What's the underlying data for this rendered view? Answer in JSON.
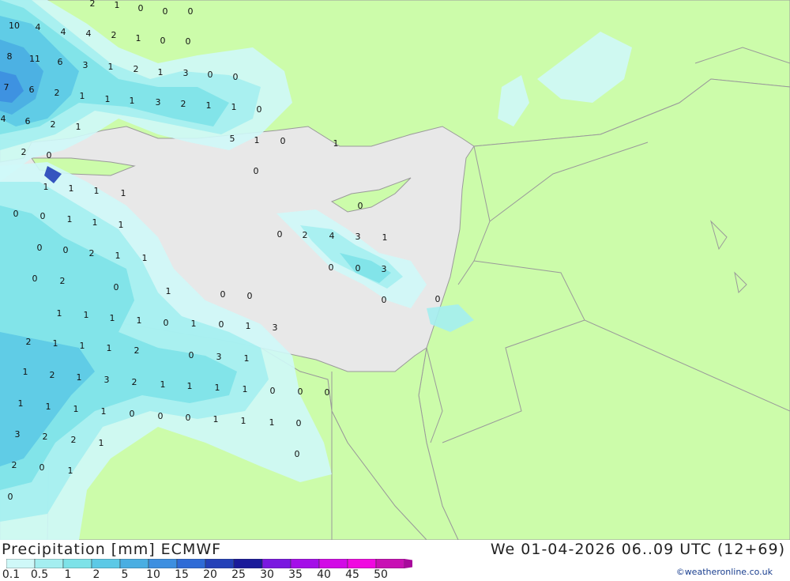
{
  "title": "Precipitation [mm] ECMWF",
  "datetime": "We 01-04-2026 06..09 UTC (12+69)",
  "credit": "©weatheronline.co.uk",
  "colors": {
    "sea": "#e8e8e8",
    "land": "#ccfcaa",
    "border": "#9a9a9a",
    "scale": [
      "#cff8f8",
      "#a4eef0",
      "#7de2e8",
      "#5cc9e6",
      "#4aaee2",
      "#3d8fe0",
      "#2f6bd6",
      "#2441b8",
      "#1a1a9a",
      "#7a18e0",
      "#a40ee8",
      "#d20ae6",
      "#f00ae0",
      "#c810b4",
      "#a80a9c"
    ]
  },
  "scale_labels": [
    "0.1",
    "0.5",
    "1",
    "2",
    "5",
    "10",
    "15",
    "20",
    "25",
    "30",
    "35",
    "40",
    "45",
    "50"
  ],
  "map_values": [
    {
      "v": "2"
    },
    {
      "v": "1"
    },
    {
      "v": "0"
    },
    {
      "v": "0"
    },
    {
      "v": "0"
    },
    {
      "v": "10"
    },
    {
      "v": "4"
    },
    {
      "v": "4"
    },
    {
      "v": "4"
    },
    {
      "v": "2"
    },
    {
      "v": "1"
    },
    {
      "v": "0"
    },
    {
      "v": "0"
    },
    {
      "v": "8"
    },
    {
      "v": "11"
    },
    {
      "v": "6"
    },
    {
      "v": "3"
    },
    {
      "v": "1"
    },
    {
      "v": "2"
    },
    {
      "v": "1"
    },
    {
      "v": "3"
    },
    {
      "v": "0"
    },
    {
      "v": "0"
    },
    {
      "v": "7"
    },
    {
      "v": "6"
    },
    {
      "v": "2"
    },
    {
      "v": "1"
    },
    {
      "v": "1"
    },
    {
      "v": "1"
    },
    {
      "v": "3"
    },
    {
      "v": "2"
    },
    {
      "v": "1"
    },
    {
      "v": "1"
    },
    {
      "v": "0"
    },
    {
      "v": "4"
    },
    {
      "v": "6"
    },
    {
      "v": "2"
    },
    {
      "v": "1"
    },
    {
      "v": "5"
    },
    {
      "v": "1"
    },
    {
      "v": "0"
    },
    {
      "v": "1"
    },
    {
      "v": "2"
    },
    {
      "v": "0"
    },
    {
      "v": "0"
    },
    {
      "v": "1"
    },
    {
      "v": "1"
    },
    {
      "v": "1"
    },
    {
      "v": "1"
    },
    {
      "v": "0"
    },
    {
      "v": "0"
    },
    {
      "v": "0"
    },
    {
      "v": "1"
    },
    {
      "v": "1"
    },
    {
      "v": "0"
    },
    {
      "v": "2"
    },
    {
      "v": "4"
    },
    {
      "v": "3"
    },
    {
      "v": "1"
    },
    {
      "v": "1"
    },
    {
      "v": "0"
    },
    {
      "v": "0"
    },
    {
      "v": "2"
    },
    {
      "v": "1"
    },
    {
      "v": "1"
    },
    {
      "v": "0"
    },
    {
      "v": "0"
    },
    {
      "v": "3"
    },
    {
      "v": "2"
    },
    {
      "v": "0"
    },
    {
      "v": "0"
    },
    {
      "v": "1"
    },
    {
      "v": "0"
    },
    {
      "v": "0"
    },
    {
      "v": "0"
    },
    {
      "v": "0"
    },
    {
      "v": "1"
    },
    {
      "v": "1"
    },
    {
      "v": "1"
    },
    {
      "v": "1"
    },
    {
      "v": "0"
    },
    {
      "v": "1"
    },
    {
      "v": "0"
    },
    {
      "v": "1"
    },
    {
      "v": "3"
    },
    {
      "v": "2"
    },
    {
      "v": "1"
    },
    {
      "v": "1"
    },
    {
      "v": "1"
    },
    {
      "v": "2"
    },
    {
      "v": "0"
    },
    {
      "v": "3"
    },
    {
      "v": "1"
    },
    {
      "v": "1"
    },
    {
      "v": "2"
    },
    {
      "v": "1"
    },
    {
      "v": "3"
    },
    {
      "v": "2"
    },
    {
      "v": "1"
    },
    {
      "v": "1"
    },
    {
      "v": "1"
    },
    {
      "v": "1"
    },
    {
      "v": "0"
    },
    {
      "v": "0"
    },
    {
      "v": "0"
    },
    {
      "v": "1"
    },
    {
      "v": "1"
    },
    {
      "v": "1"
    },
    {
      "v": "1"
    },
    {
      "v": "0"
    },
    {
      "v": "0"
    },
    {
      "v": "0"
    },
    {
      "v": "1"
    },
    {
      "v": "1"
    },
    {
      "v": "1"
    },
    {
      "v": "0"
    },
    {
      "v": "3"
    },
    {
      "v": "2"
    },
    {
      "v": "2"
    },
    {
      "v": "1"
    },
    {
      "v": "2"
    },
    {
      "v": "0"
    },
    {
      "v": "1"
    },
    {
      "v": "0"
    },
    {
      "v": "0"
    }
  ]
}
